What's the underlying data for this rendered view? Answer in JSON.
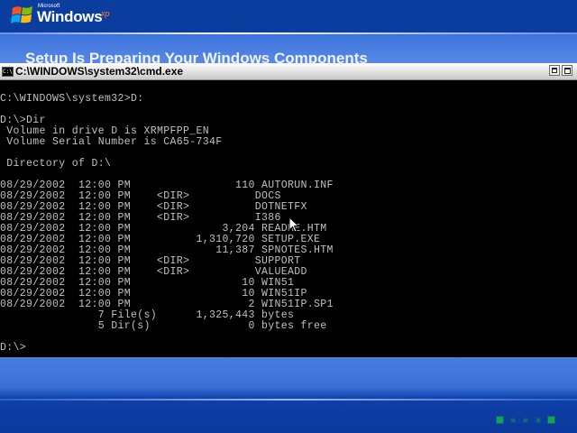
{
  "background": {
    "logo": {
      "maker": "Microsoft",
      "product": "Windows",
      "edition": "xp"
    },
    "setup_title": "Setup Is Preparing Your Windows Components"
  },
  "window": {
    "title": "C:\\WINDOWS\\system32\\cmd.exe",
    "minimize_label": "_",
    "maximize_label": "□"
  },
  "console": {
    "lines": [
      "C:\\WINDOWS\\system32>D:",
      "",
      "D:\\>Dir",
      " Volume in drive D is XRMPFPP_EN",
      " Volume Serial Number is CA65-734F",
      "",
      " Directory of D:\\",
      "",
      "08/29/2002  12:00 PM                110 AUTORUN.INF",
      "08/29/2002  12:00 PM    <DIR>          DOCS",
      "08/29/2002  12:00 PM    <DIR>          DOTNETFX",
      "08/29/2002  12:00 PM    <DIR>          I386",
      "08/29/2002  12:00 PM              3,204 README.HTM",
      "08/29/2002  12:00 PM          1,310,720 SETUP.EXE",
      "08/29/2002  12:00 PM             11,387 SPNOTES.HTM",
      "08/29/2002  12:00 PM    <DIR>          SUPPORT",
      "08/29/2002  12:00 PM    <DIR>          VALUEADD",
      "08/29/2002  12:00 PM                 10 WIN51",
      "08/29/2002  12:00 PM                 10 WIN51IP",
      "08/29/2002  12:00 PM                  2 WIN51IP.SP1",
      "               7 File(s)      1,325,443 bytes",
      "               5 Dir(s)               0 bytes free",
      "",
      "D:\\>"
    ]
  },
  "colors": {
    "console_text": "#c0c0c0",
    "console_bg": "#000000",
    "desktop_blue": "#2f62cc"
  }
}
